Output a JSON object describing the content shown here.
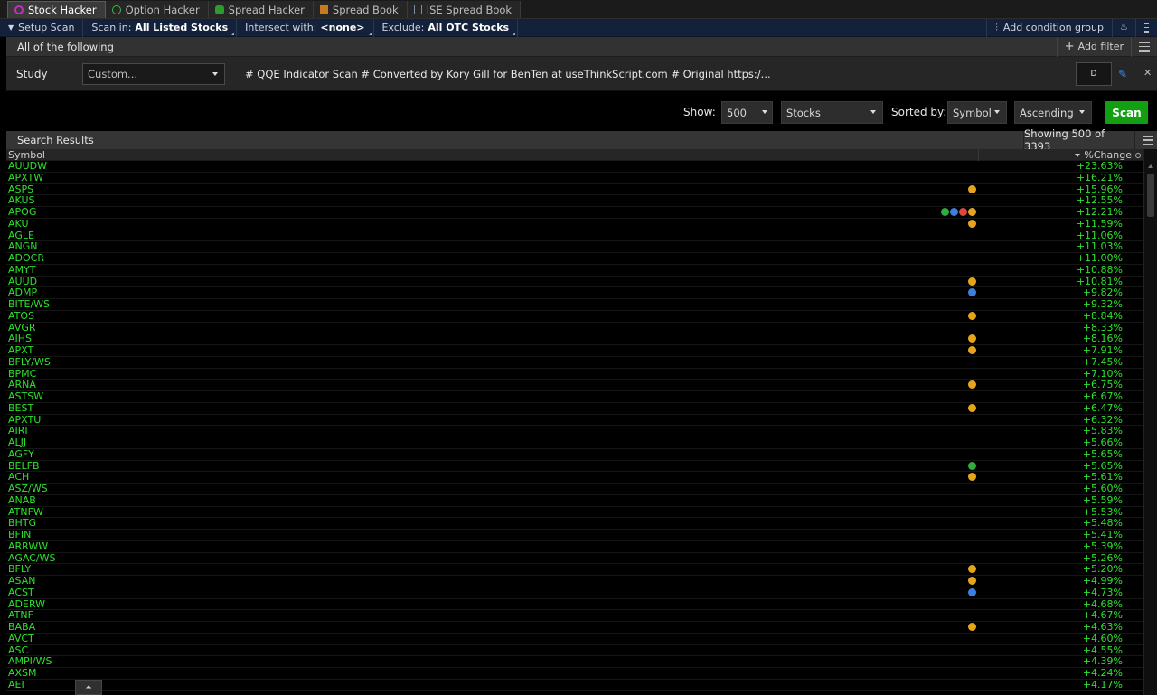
{
  "tabs": [
    {
      "label": "Stock Hacker",
      "icon": "stock-hacker-icon",
      "active": true
    },
    {
      "label": "Option Hacker",
      "icon": "option-hacker-icon",
      "active": false
    },
    {
      "label": "Spread Hacker",
      "icon": "spread-hacker-icon",
      "active": false
    },
    {
      "label": "Spread Book",
      "icon": "spread-book-icon",
      "active": false
    },
    {
      "label": "ISE Spread Book",
      "icon": "ise-spread-book-icon",
      "active": false
    }
  ],
  "setup": {
    "setup_scan": "Setup Scan",
    "scan_in_label": "Scan in:",
    "scan_in_value": "All Listed Stocks",
    "intersect_label": "Intersect with:",
    "intersect_value": "<none>",
    "exclude_label": "Exclude:",
    "exclude_value": "All OTC Stocks",
    "add_condition_group": "Add condition group"
  },
  "filter": {
    "header": "All of the following",
    "add_filter": "Add filter",
    "study_label": "Study",
    "study_select": "Custom...",
    "formula": "# QQE Indicator Scan # Converted by Kory Gill for BenTen at useThinkScript.com # Original https:/...",
    "aggregation": "D"
  },
  "controls": {
    "show_label": "Show:",
    "show_value": "500",
    "type_value": "Stocks",
    "sorted_label": "Sorted by:",
    "sort_field": "Symbol",
    "sort_order": "Ascending",
    "scan_button": "Scan"
  },
  "results": {
    "title": "Search Results",
    "showing": "Showing 500 of 3393",
    "col_symbol": "Symbol",
    "col_change": "%Change",
    "rows": [
      {
        "symbol": "AUUDW",
        "change": "+23.63%",
        "icons": []
      },
      {
        "symbol": "APXTW",
        "change": "+16.21%",
        "icons": []
      },
      {
        "symbol": "ASPS",
        "change": "+15.96%",
        "icons": [
          "o"
        ]
      },
      {
        "symbol": "AKUS",
        "change": "+12.55%",
        "icons": []
      },
      {
        "symbol": "APOG",
        "change": "+12.21%",
        "icons": [
          "g",
          "b",
          "r",
          "o"
        ]
      },
      {
        "symbol": "AKU",
        "change": "+11.59%",
        "icons": [
          "o"
        ]
      },
      {
        "symbol": "AGLE",
        "change": "+11.06%",
        "icons": []
      },
      {
        "symbol": "ANGN",
        "change": "+11.03%",
        "icons": []
      },
      {
        "symbol": "ADOCR",
        "change": "+11.00%",
        "icons": []
      },
      {
        "symbol": "AMYT",
        "change": "+10.88%",
        "icons": []
      },
      {
        "symbol": "AUUD",
        "change": "+10.81%",
        "icons": [
          "o"
        ]
      },
      {
        "symbol": "ADMP",
        "change": "+9.82%",
        "icons": [
          "b"
        ]
      },
      {
        "symbol": "BITE/WS",
        "change": "+9.32%",
        "icons": []
      },
      {
        "symbol": "ATOS",
        "change": "+8.84%",
        "icons": [
          "o"
        ]
      },
      {
        "symbol": "AVGR",
        "change": "+8.33%",
        "icons": []
      },
      {
        "symbol": "AIHS",
        "change": "+8.16%",
        "icons": [
          "o"
        ]
      },
      {
        "symbol": "APXT",
        "change": "+7.91%",
        "icons": [
          "o"
        ]
      },
      {
        "symbol": "BFLY/WS",
        "change": "+7.45%",
        "icons": []
      },
      {
        "symbol": "BPMC",
        "change": "+7.10%",
        "icons": []
      },
      {
        "symbol": "ARNA",
        "change": "+6.75%",
        "icons": [
          "o"
        ]
      },
      {
        "symbol": "ASTSW",
        "change": "+6.67%",
        "icons": []
      },
      {
        "symbol": "BEST",
        "change": "+6.47%",
        "icons": [
          "o"
        ]
      },
      {
        "symbol": "APXTU",
        "change": "+6.32%",
        "icons": []
      },
      {
        "symbol": "AIRI",
        "change": "+5.83%",
        "icons": []
      },
      {
        "symbol": "ALJJ",
        "change": "+5.66%",
        "icons": []
      },
      {
        "symbol": "AGFY",
        "change": "+5.65%",
        "icons": []
      },
      {
        "symbol": "BELFB",
        "change": "+5.65%",
        "icons": [
          "g"
        ]
      },
      {
        "symbol": "ACH",
        "change": "+5.61%",
        "icons": [
          "o"
        ]
      },
      {
        "symbol": "ASZ/WS",
        "change": "+5.60%",
        "icons": []
      },
      {
        "symbol": "ANAB",
        "change": "+5.59%",
        "icons": []
      },
      {
        "symbol": "ATNFW",
        "change": "+5.53%",
        "icons": []
      },
      {
        "symbol": "BHTG",
        "change": "+5.48%",
        "icons": []
      },
      {
        "symbol": "BFIN",
        "change": "+5.41%",
        "icons": []
      },
      {
        "symbol": "ARRWW",
        "change": "+5.39%",
        "icons": []
      },
      {
        "symbol": "AGAC/WS",
        "change": "+5.26%",
        "icons": []
      },
      {
        "symbol": "BFLY",
        "change": "+5.20%",
        "icons": [
          "o"
        ]
      },
      {
        "symbol": "ASAN",
        "change": "+4.99%",
        "icons": [
          "o"
        ]
      },
      {
        "symbol": "ACST",
        "change": "+4.73%",
        "icons": [
          "b"
        ]
      },
      {
        "symbol": "ADERW",
        "change": "+4.68%",
        "icons": []
      },
      {
        "symbol": "ATNF",
        "change": "+4.67%",
        "icons": []
      },
      {
        "symbol": "BABA",
        "change": "+4.63%",
        "icons": [
          "o"
        ]
      },
      {
        "symbol": "AVCT",
        "change": "+4.60%",
        "icons": []
      },
      {
        "symbol": "ASC",
        "change": "+4.55%",
        "icons": []
      },
      {
        "symbol": "AMPI/WS",
        "change": "+4.39%",
        "icons": []
      },
      {
        "symbol": "AXSM",
        "change": "+4.24%",
        "icons": []
      },
      {
        "symbol": "AEI",
        "change": "+4.17%",
        "icons": []
      }
    ]
  },
  "colors": {
    "positive": "#2ee02e",
    "scan_button": "#12a012",
    "setup_bar": "#14213a"
  }
}
